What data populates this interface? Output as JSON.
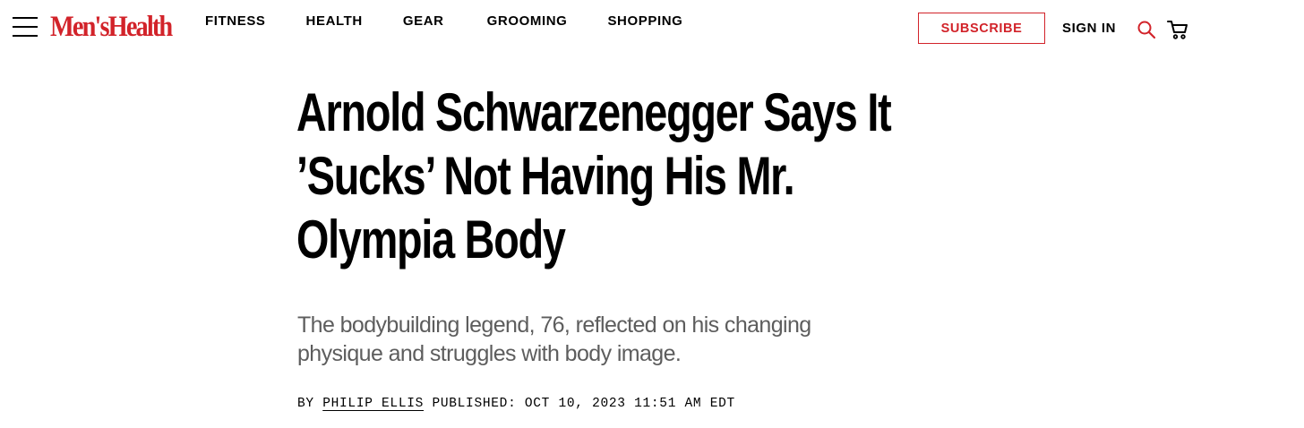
{
  "header": {
    "logo_text": "Men'sHealth",
    "nav": [
      {
        "label": "FITNESS"
      },
      {
        "label": "HEALTH"
      },
      {
        "label": "GEAR"
      },
      {
        "label": "GROOMING"
      },
      {
        "label": "SHOPPING"
      }
    ],
    "subscribe_label": "SUBSCRIBE",
    "signin_label": "SIGN IN",
    "icons": {
      "menu": "hamburger-menu-icon",
      "search": "search-icon",
      "cart": "cart-icon"
    }
  },
  "article": {
    "headline": "Arnold Schwarzenegger Says It ’Sucks’ Not Having His Mr. Olympia Body",
    "dek": "The bodybuilding legend, 76, reflected on his changing physique and struggles with body image.",
    "by_label": "BY",
    "author": "PHILIP ELLIS",
    "published_label": "PUBLISHED:",
    "published_date": "OCT 10, 2023 11:51 AM EDT"
  },
  "colors": {
    "brand_red": "#d2232a",
    "text": "#000000",
    "dek_gray": "#5d5d5d",
    "background": "#ffffff"
  }
}
